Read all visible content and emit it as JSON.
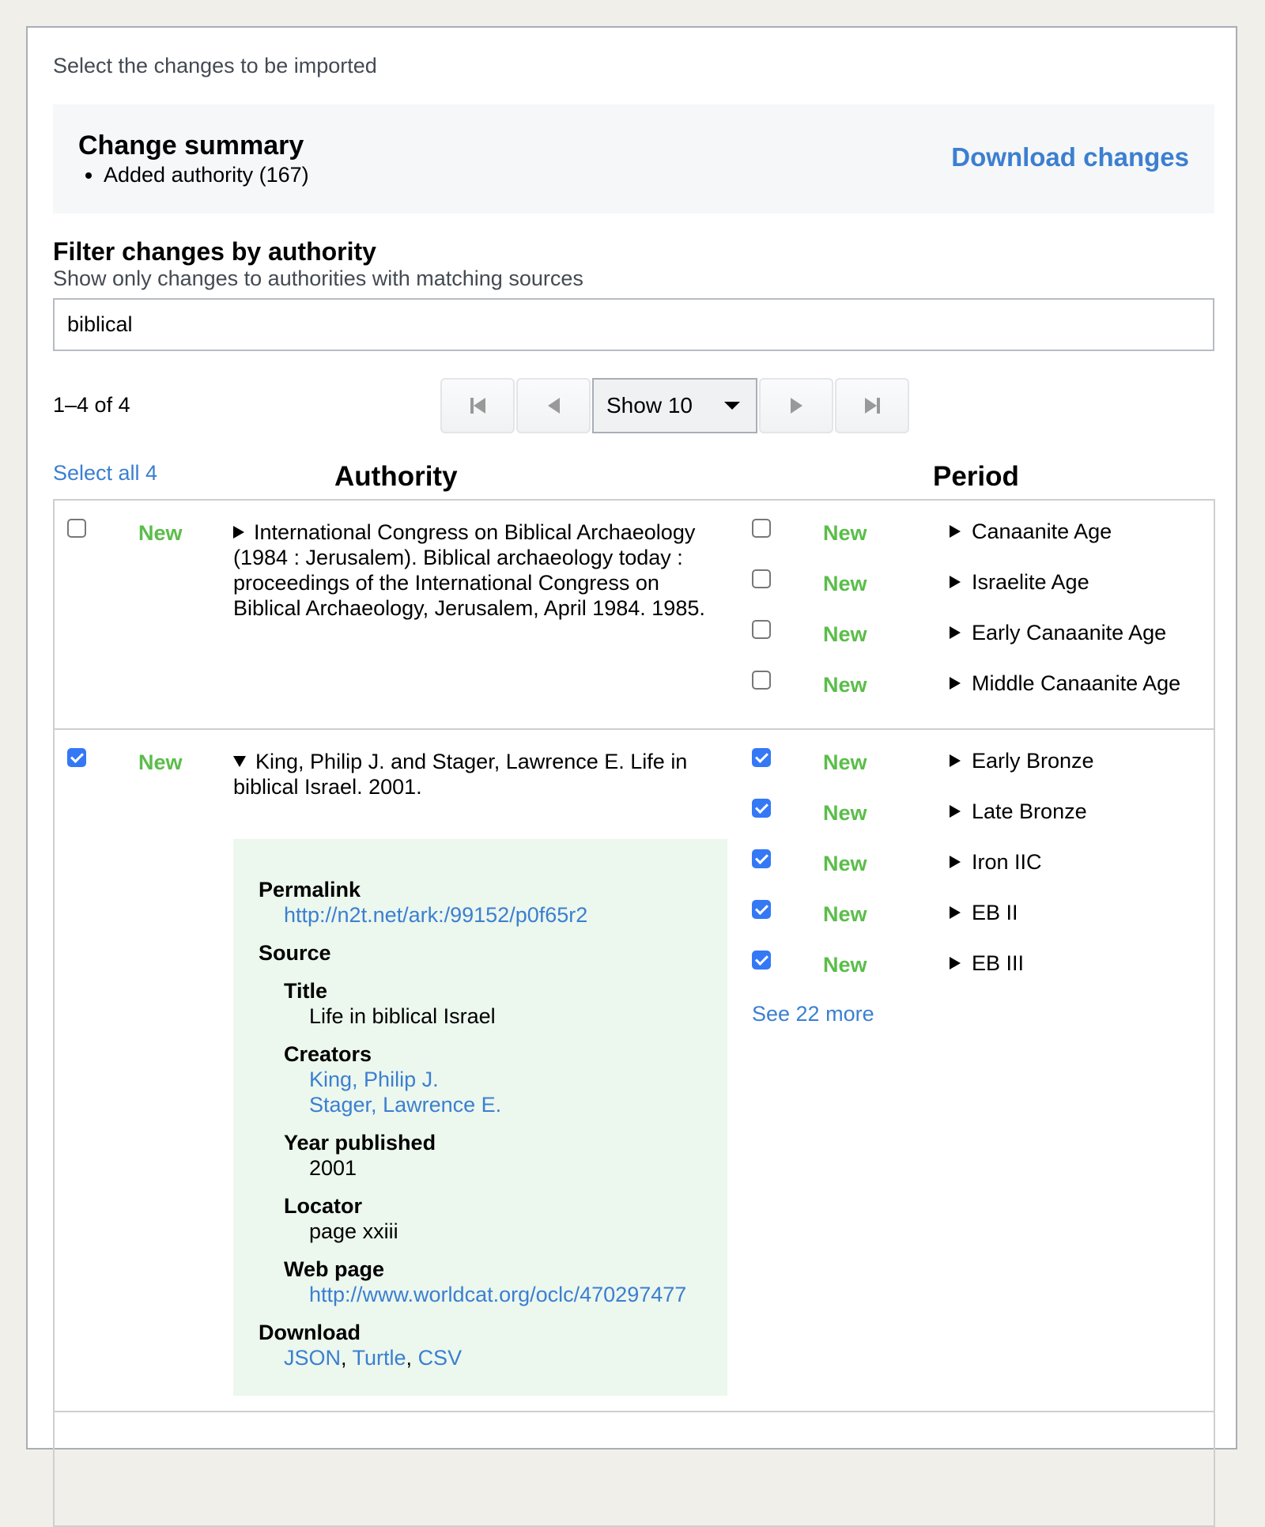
{
  "intro": "Select the changes to be imported",
  "summary": {
    "title": "Change summary",
    "items": [
      "Added authority (167)"
    ],
    "download_label": "Download changes"
  },
  "filter": {
    "title": "Filter changes by authority",
    "subtitle": "Show only changes to authorities with matching sources",
    "value": "biblical"
  },
  "pagination": {
    "count_text": "1–4 of 4",
    "show_label": "Show 10"
  },
  "table": {
    "select_all_label": "Select all 4",
    "columns": [
      "Authority",
      "Period"
    ],
    "rows": [
      {
        "checked": false,
        "status": "New",
        "expanded": false,
        "authority": "International Congress on Biblical Archaeology (1984 : Jerusalem). Biblical archaeology today : proceedings of the International Congress on Biblical Archaeology, Jerusalem, April 1984. 1985.",
        "periods": [
          {
            "checked": false,
            "status": "New",
            "label": "Canaanite Age"
          },
          {
            "checked": false,
            "status": "New",
            "label": "Israelite Age"
          },
          {
            "checked": false,
            "status": "New",
            "label": "Early Canaanite Age"
          },
          {
            "checked": false,
            "status": "New",
            "label": "Middle Canaanite Age"
          }
        ]
      },
      {
        "checked": true,
        "status": "New",
        "expanded": true,
        "authority": "King, Philip J. and Stager, Lawrence E. Life in biblical Israel. 2001.",
        "periods": [
          {
            "checked": true,
            "status": "New",
            "label": "Early Bronze"
          },
          {
            "checked": true,
            "status": "New",
            "label": "Late Bronze"
          },
          {
            "checked": true,
            "status": "New",
            "label": "Iron IIC"
          },
          {
            "checked": true,
            "status": "New",
            "label": "EB II"
          },
          {
            "checked": true,
            "status": "New",
            "label": "EB III"
          }
        ],
        "see_more": "See 22 more",
        "detail": {
          "permalink_label": "Permalink",
          "permalink": "http://n2t.net/ark:/99152/p0f65r2",
          "source_label": "Source",
          "title_label": "Title",
          "title": "Life in biblical Israel",
          "creators_label": "Creators",
          "creators": [
            "King, Philip J.",
            "Stager, Lawrence E."
          ],
          "year_label": "Year published",
          "year": "2001",
          "locator_label": "Locator",
          "locator": "page xxiii",
          "webpage_label": "Web page",
          "webpage": "http://www.worldcat.org/oclc/470297477",
          "download_label": "Download",
          "downloads": [
            "JSON",
            "Turtle",
            "CSV"
          ]
        }
      }
    ]
  },
  "colors": {
    "accent": "#3b7fd0",
    "new_status": "#5bbd4a",
    "detail_bg": "#ecf7ee",
    "checkbox_on": "#3478f6"
  }
}
